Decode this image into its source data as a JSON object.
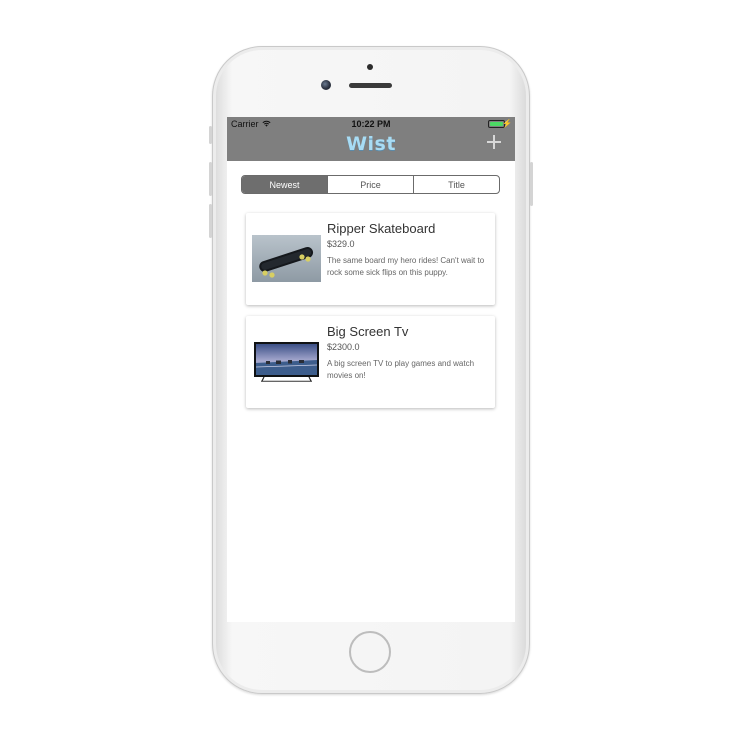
{
  "status_bar": {
    "carrier": "Carrier",
    "time": "10:22 PM"
  },
  "nav": {
    "title": "Wist",
    "add_icon": "plus-icon"
  },
  "sort": {
    "options": [
      "Newest",
      "Price",
      "Title"
    ],
    "selected": "Newest"
  },
  "items": [
    {
      "title": "Ripper Skateboard",
      "price": "$329.0",
      "description": "The same board my hero rides! Can't wait to rock some sick flips on this puppy.",
      "image": "skateboard"
    },
    {
      "title": "Big Screen Tv",
      "price": "$2300.0",
      "description": "A big screen TV to play games and watch movies on!",
      "image": "television"
    }
  ],
  "colors": {
    "nav_background": "#7f7f7f",
    "logo": "#a8dcf4",
    "segment_active": "#6e6e6e",
    "battery": "#4cd964"
  }
}
